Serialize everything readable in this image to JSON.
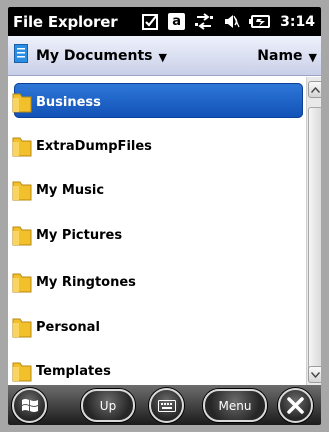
{
  "status_bar": {
    "app_title": "File Explorer",
    "time": "3:14",
    "icons": [
      "checkbox-icon",
      "a-input-mode-icon",
      "connectivity-arrows-icon",
      "volume-icon",
      "battery-icon"
    ],
    "a_label": "a"
  },
  "header": {
    "folder": "My Documents",
    "sort": "Name"
  },
  "files": [
    {
      "name": "Business",
      "selected": true
    },
    {
      "name": "ExtraDumpFiles",
      "selected": false
    },
    {
      "name": "My Music",
      "selected": false
    },
    {
      "name": "My Pictures",
      "selected": false
    },
    {
      "name": "My Ringtones",
      "selected": false
    },
    {
      "name": "Personal",
      "selected": false
    },
    {
      "name": "Templates",
      "selected": false
    }
  ],
  "softkeys": {
    "left": "Up",
    "right": "Menu"
  },
  "colors": {
    "selection": "#1e62c9",
    "header_bg": "#dfe3f3",
    "folder_icon": "#f2c02a"
  }
}
